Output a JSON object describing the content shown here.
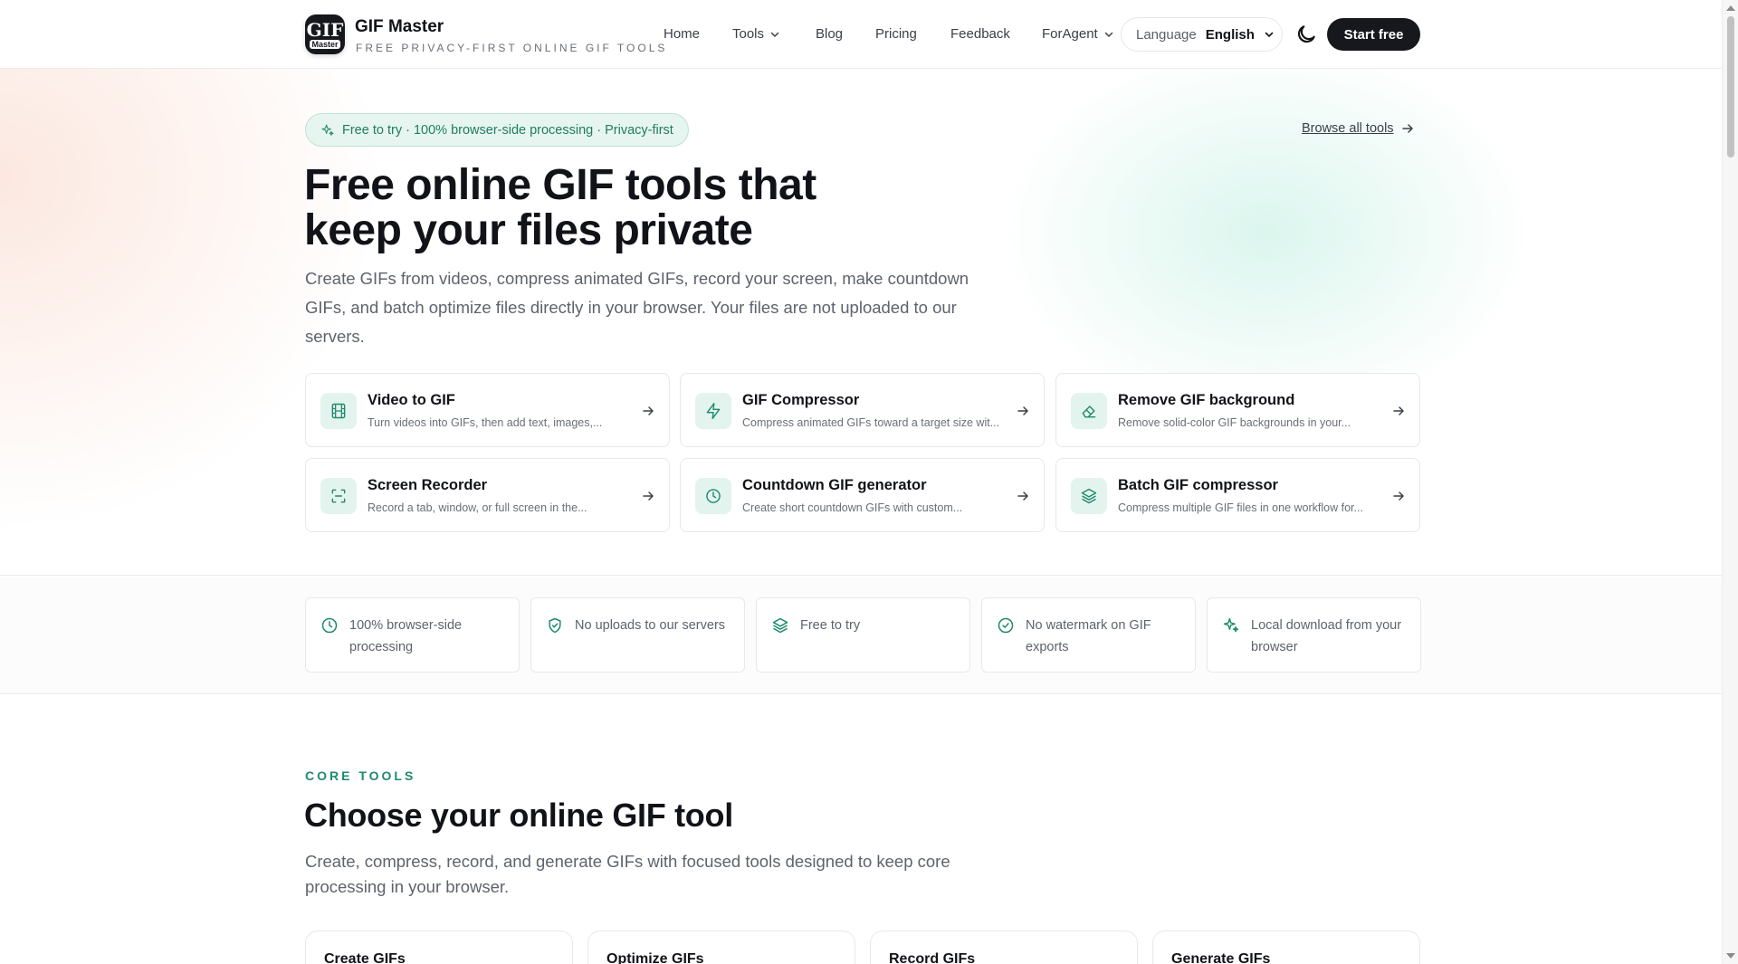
{
  "header": {
    "logo_line1": "GIF",
    "logo_line2": "Master",
    "brand_name": "GIF Master",
    "brand_tagline": "FREE PRIVACY-FIRST ONLINE GIF TOOLS",
    "nav": {
      "home": "Home",
      "tools": "Tools",
      "blog": "Blog",
      "pricing": "Pricing",
      "feedback": "Feedback",
      "foragent": "ForAgent"
    },
    "language_label": "Language",
    "language_value": "English",
    "start_button": "Start free"
  },
  "hero": {
    "pill_text": "Free to try · 100% browser-side processing · Privacy-first",
    "browse_link": "Browse all tools",
    "title_line1": "Free online GIF tools that",
    "title_line2": "keep your files private",
    "description": "Create GIFs from videos, compress animated GIFs, record your screen, make countdown GIFs, and batch optimize files directly in your browser. Your files are not uploaded to our servers.",
    "tools": [
      {
        "title": "Video to GIF",
        "desc": "Turn videos into GIFs, then add text, images,...",
        "icon": "film-icon"
      },
      {
        "title": "GIF Compressor",
        "desc": "Compress animated GIFs toward a target size wit...",
        "icon": "bolt-icon"
      },
      {
        "title": "Remove GIF background",
        "desc": "Remove solid-color GIF backgrounds in your...",
        "icon": "eraser-icon"
      },
      {
        "title": "Screen Recorder",
        "desc": "Record a tab, window, or full screen in the...",
        "icon": "scan-icon"
      },
      {
        "title": "Countdown GIF generator",
        "desc": "Create short countdown GIFs with custom...",
        "icon": "clock-icon"
      },
      {
        "title": "Batch GIF compressor",
        "desc": "Compress multiple GIF files in one workflow for...",
        "icon": "layers-icon"
      }
    ]
  },
  "features": [
    {
      "text": "100% browser-side processing",
      "icon": "clock-icon"
    },
    {
      "text": "No uploads to our servers",
      "icon": "shield-check-icon"
    },
    {
      "text": "Free to try",
      "icon": "layers-icon"
    },
    {
      "text": "No watermark on GIF exports",
      "icon": "check-circle-icon"
    },
    {
      "text": "Local download from your browser",
      "icon": "sparkle-icon"
    }
  ],
  "core": {
    "label": "CORE TOOLS",
    "title": "Choose your online GIF tool",
    "description": "Create, compress, record, and generate GIFs with focused tools designed to keep core processing in your browser.",
    "categories": [
      "Create GIFs",
      "Optimize GIFs",
      "Record GIFs",
      "Generate GIFs"
    ]
  },
  "colors": {
    "accent": "#1f8a6c",
    "accent_bg": "#e3f4ee",
    "dark": "#16181d"
  }
}
